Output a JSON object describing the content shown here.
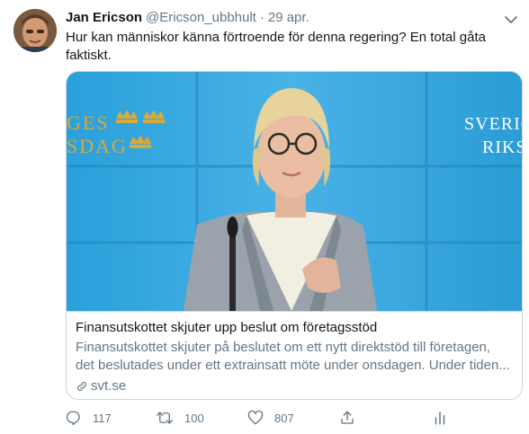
{
  "author": {
    "name": "Jan Ericson",
    "handle": "@Ericson_ubbhult",
    "separator": "·",
    "date": "29 apr."
  },
  "tweet": {
    "text": "Hur kan människor känna förtroende för denna regering? En total gåta faktiskt."
  },
  "card": {
    "title": "Finansutskottet skjuter upp beslut om företagsstöd",
    "desc_line1": "Finansutskottet skjuter på beslutet om ett nytt direktstöd till företagen,",
    "desc_line2": "det beslutades under ett extrainsatt möte under onsdagen. Under tiden...",
    "domain": "svt.se",
    "backdrop_left": [
      "GES",
      "SDAG"
    ],
    "backdrop_right": [
      "SVERIG",
      "RIKS"
    ]
  },
  "actions": {
    "reply_count": "117",
    "retweet_count": "100",
    "like_count": "807"
  },
  "colors": {
    "text": "#14171a",
    "muted": "#657786",
    "border": "#ccd6dd",
    "backdrop": "#35a6e0",
    "gold": "#d9a93a"
  },
  "icons": [
    "avatar",
    "chevron-down-icon",
    "reply-icon",
    "retweet-icon",
    "like-icon",
    "share-icon",
    "analytics-icon",
    "link-icon"
  ]
}
